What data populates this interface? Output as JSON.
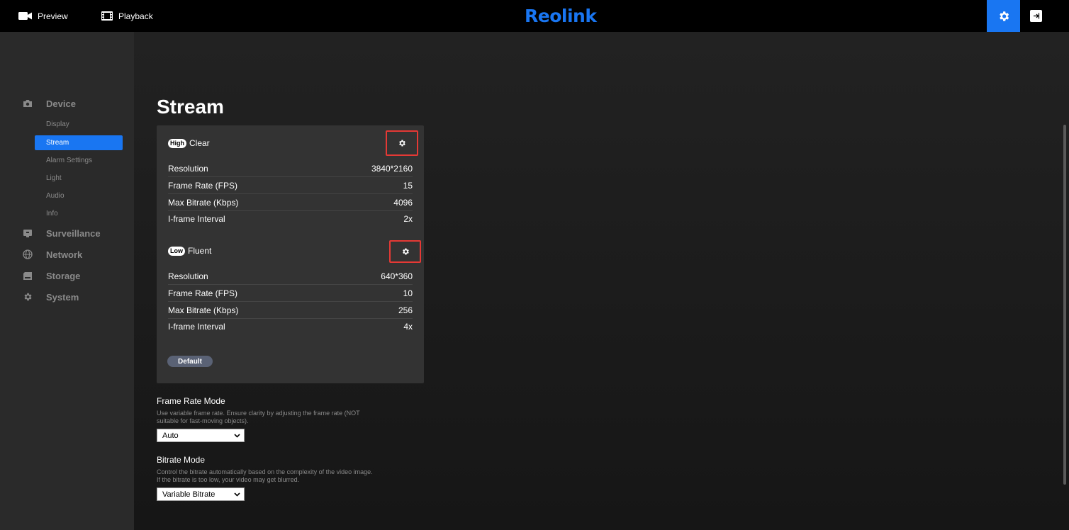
{
  "topbar": {
    "preview_label": "Preview",
    "playback_label": "Playback",
    "logo_text": "Reolink",
    "accent_color": "#1976f2"
  },
  "sidebar": {
    "groups": [
      {
        "label": "Device",
        "icon": "camera-icon"
      },
      {
        "label": "Surveillance",
        "icon": "monitor-icon"
      },
      {
        "label": "Network",
        "icon": "globe-icon"
      },
      {
        "label": "Storage",
        "icon": "storage-icon"
      },
      {
        "label": "System",
        "icon": "gear-icon"
      }
    ],
    "device_items": [
      "Display",
      "Stream",
      "Alarm Settings",
      "Light",
      "Audio",
      "Info"
    ],
    "active_item": "Stream"
  },
  "page": {
    "title": "Stream"
  },
  "streams": [
    {
      "badge": "High",
      "name": "Clear",
      "rows": [
        {
          "label": "Resolution",
          "value": "3840*2160"
        },
        {
          "label": "Frame Rate (FPS)",
          "value": "15"
        },
        {
          "label": "Max Bitrate (Kbps)",
          "value": "4096"
        },
        {
          "label": "I-frame Interval",
          "value": "2x"
        }
      ]
    },
    {
      "badge": "Low",
      "name": "Fluent",
      "rows": [
        {
          "label": "Resolution",
          "value": "640*360"
        },
        {
          "label": "Frame Rate (FPS)",
          "value": "10"
        },
        {
          "label": "Max Bitrate (Kbps)",
          "value": "256"
        },
        {
          "label": "I-frame Interval",
          "value": "4x"
        }
      ]
    }
  ],
  "default_button": "Default",
  "frame_rate_mode": {
    "title": "Frame Rate Mode",
    "description": "Use variable frame rate. Ensure clarity by adjusting the frame rate (NOT suitable for fast-moving objects).",
    "value": "Auto"
  },
  "bitrate_mode": {
    "title": "Bitrate Mode",
    "description": "Control the bitrate automatically based on the complexity of the video image. If the bitrate is too low, your video may get blurred.",
    "value": "Variable Bitrate"
  }
}
